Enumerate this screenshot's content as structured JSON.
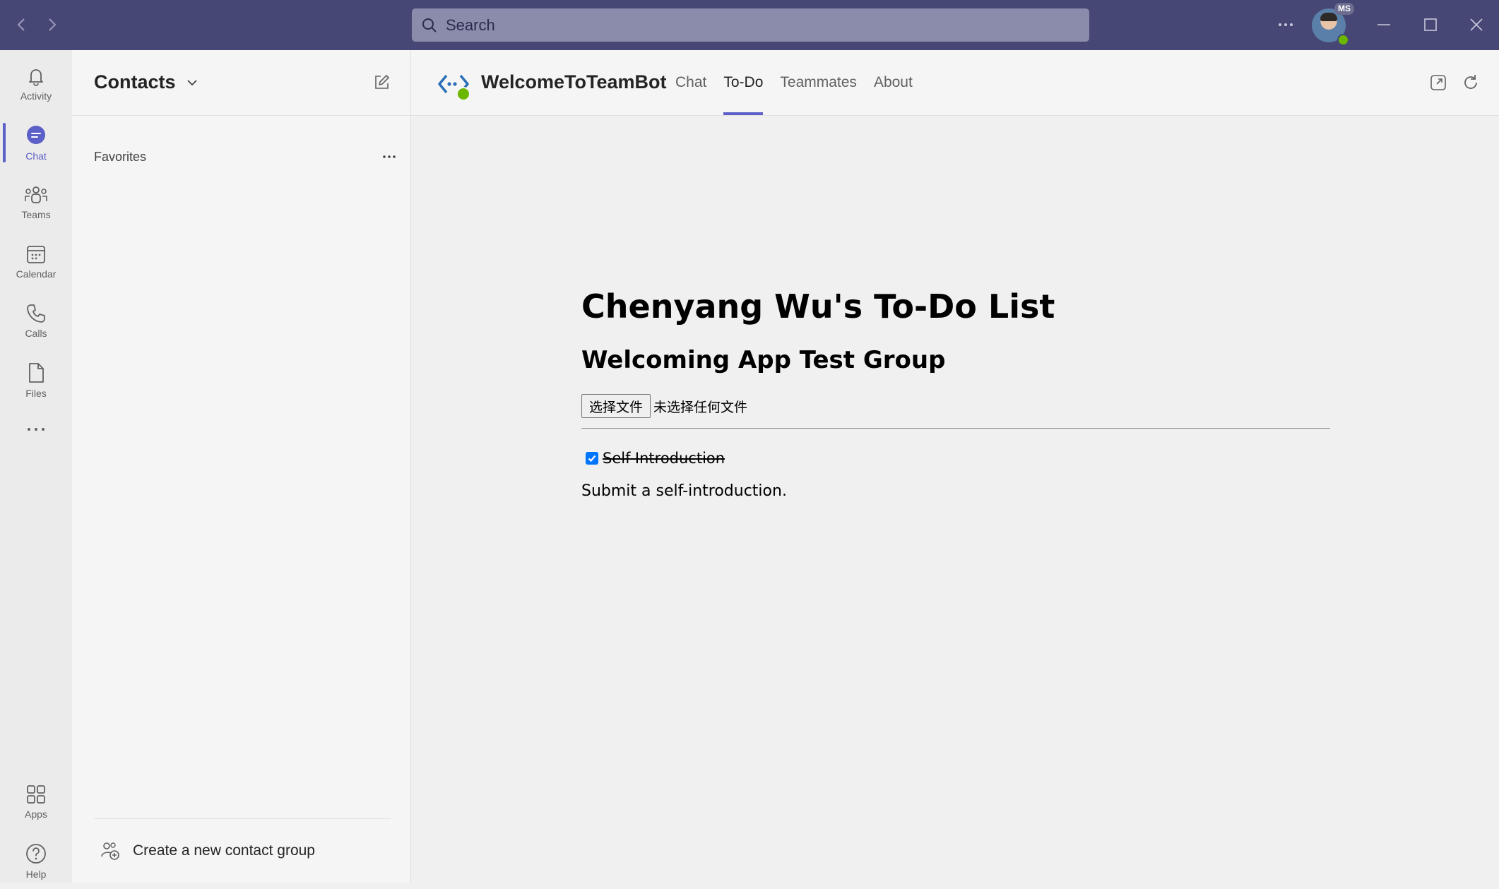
{
  "titlebar": {
    "search_placeholder": "Search",
    "avatar_badge": "MS",
    "presence": "available"
  },
  "rail": {
    "items": [
      {
        "label": "Activity",
        "icon": "bell-icon"
      },
      {
        "label": "Chat",
        "icon": "chat-icon",
        "active": true
      },
      {
        "label": "Teams",
        "icon": "teams-icon"
      },
      {
        "label": "Calendar",
        "icon": "calendar-icon"
      },
      {
        "label": "Calls",
        "icon": "phone-icon"
      },
      {
        "label": "Files",
        "icon": "file-icon"
      }
    ],
    "bottom_items": [
      {
        "label": "Apps",
        "icon": "apps-icon"
      },
      {
        "label": "Help",
        "icon": "help-icon"
      }
    ]
  },
  "contacts": {
    "title": "Contacts",
    "favorites_label": "Favorites",
    "new_group_label": "Create a new contact group"
  },
  "app": {
    "name": "WelcomeToTeamBot",
    "tabs": [
      "Chat",
      "To-Do",
      "Teammates",
      "About"
    ],
    "active_tab": "To-Do"
  },
  "todo": {
    "heading": "Chenyang Wu's To-Do List",
    "group": "Welcoming App Test Group",
    "file_button": "选择文件",
    "file_status": "未选择任何文件",
    "tasks": [
      {
        "title": "Self-Introduction",
        "done": true,
        "description": "Submit a self-introduction."
      }
    ]
  },
  "colors": {
    "titlebar": "#464775",
    "accent": "#5b5fc7",
    "presence_green": "#6bb700",
    "checkbox": "#0075ff"
  }
}
